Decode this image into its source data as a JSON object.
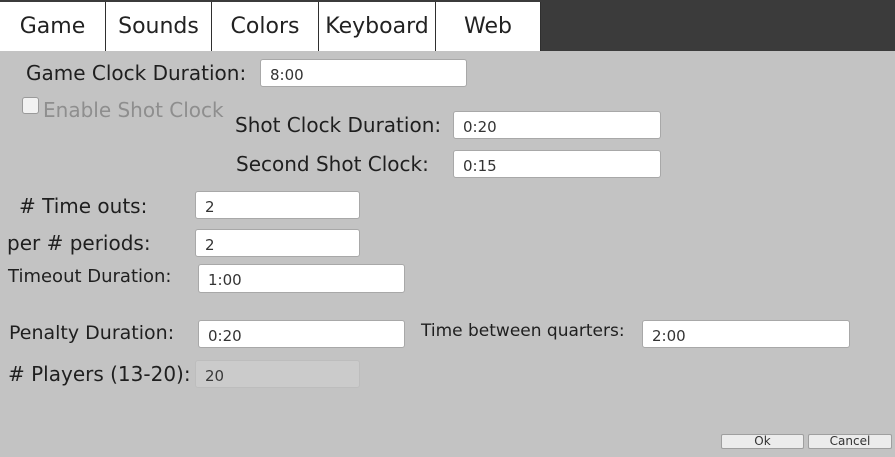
{
  "tabs": [
    "Game",
    "Sounds",
    "Colors",
    "Keyboard",
    "Web"
  ],
  "fields": {
    "game_clock": {
      "label": "Game Clock Duration:",
      "value": "8:00"
    },
    "enable_shot_clock": {
      "label": "Enable Shot Clock",
      "checked": false
    },
    "shot_clock": {
      "label": "Shot Clock Duration:",
      "value": "0:20"
    },
    "second_shot_clock": {
      "label": "Second Shot Clock:",
      "value": "0:15"
    },
    "time_outs": {
      "label": "# Time outs:",
      "value": "2"
    },
    "per_periods": {
      "label": "per # periods:",
      "value": "2"
    },
    "timeout_duration": {
      "label": "Timeout Duration:",
      "value": "1:00"
    },
    "penalty_duration": {
      "label": "Penalty Duration:",
      "value": "0:20"
    },
    "time_between_quarters": {
      "label": "Time between quarters:",
      "value": "2:00"
    },
    "players": {
      "label": "# Players (13-20):",
      "value": "20",
      "disabled": true
    }
  },
  "buttons": {
    "ok": "Ok",
    "cancel": "Cancel"
  },
  "colors": {
    "background": "#c3c3c3",
    "tab_bar": "#3b3b3b",
    "tab": "#ffffff",
    "field": "#ffffff"
  }
}
